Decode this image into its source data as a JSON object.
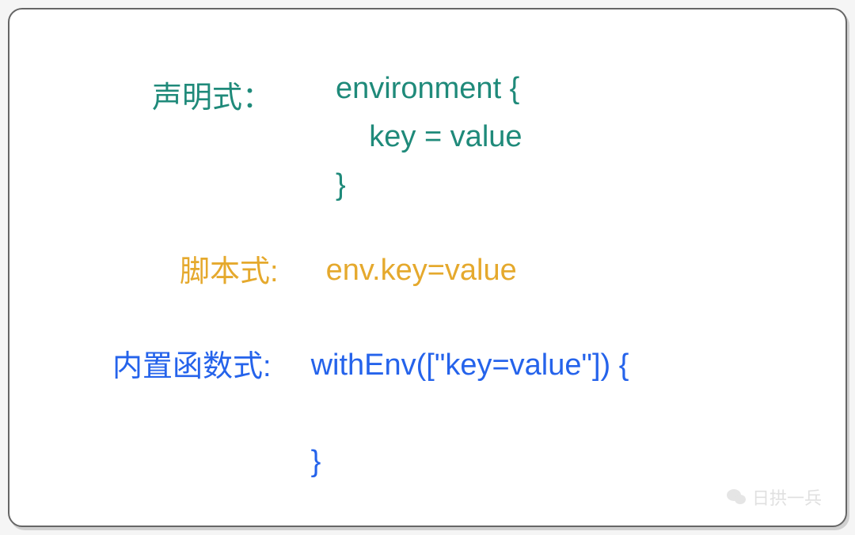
{
  "sections": {
    "declarative": {
      "label": "声明式：",
      "code_line1": "environment {",
      "code_line2": "    key = value",
      "code_line3": "}"
    },
    "script": {
      "label": "脚本式:",
      "code": "env.key=value"
    },
    "builtin": {
      "label": "内置函数式:",
      "code_line1": "withEnv([\"key=value\"]) {",
      "code_line2": "",
      "code_line3": "}"
    }
  },
  "watermark": {
    "text": "日拱一兵"
  },
  "colors": {
    "teal": "#1f8a7a",
    "gold": "#e5a92d",
    "blue": "#2563eb"
  }
}
